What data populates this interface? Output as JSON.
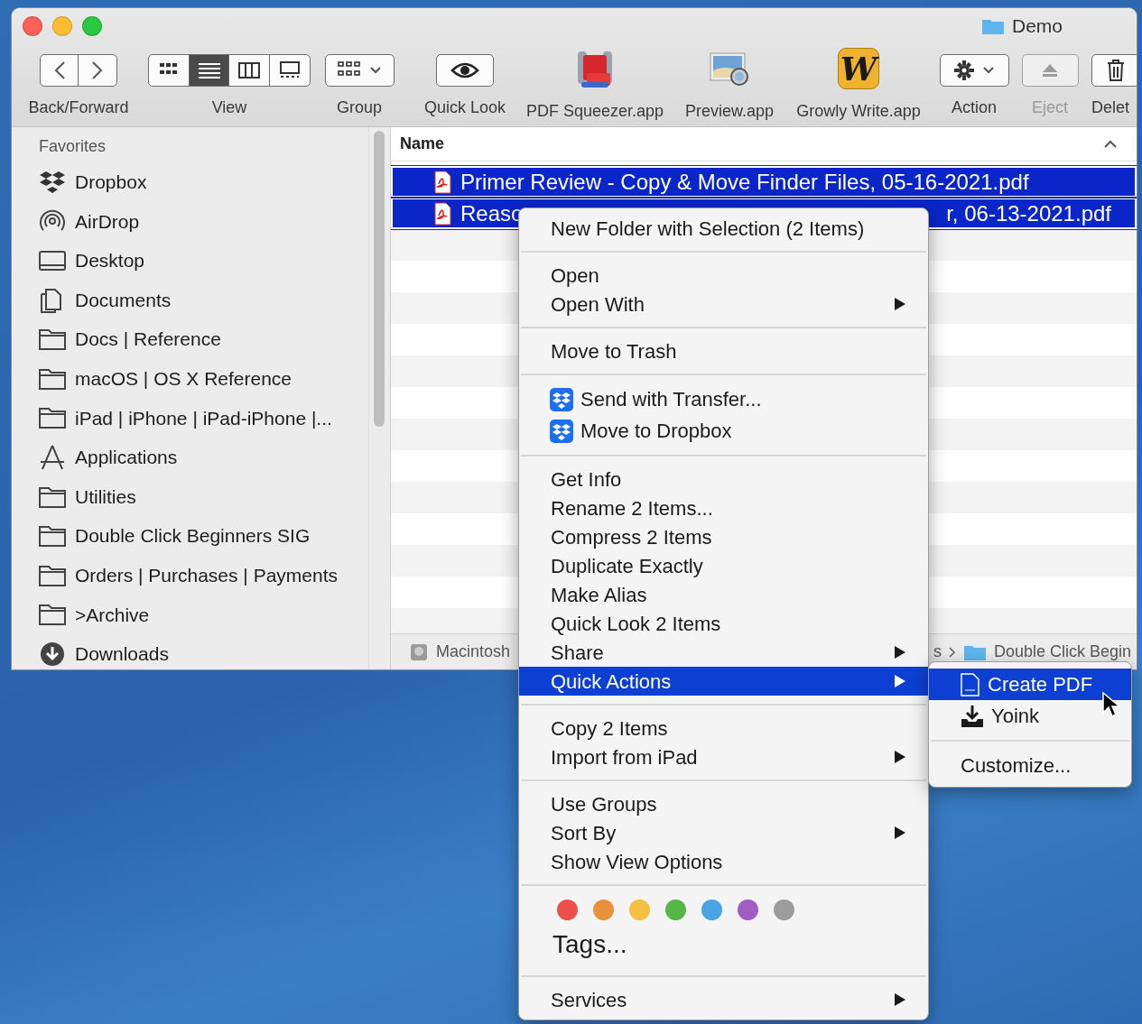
{
  "window": {
    "title": "Demo"
  },
  "toolbar": [
    {
      "kind": "navigation",
      "label": "Back/Forward"
    },
    {
      "kind": "viewmodes",
      "label": "View",
      "modes": [
        {
          "selected": false
        },
        {
          "selected": true
        },
        {
          "selected": false
        },
        {
          "selected": false
        }
      ]
    },
    {
      "kind": "groupmenu",
      "label": "Group"
    },
    {
      "kind": "quicklook",
      "label": "Quick Look"
    },
    {
      "kind": "pdfapp",
      "label": "PDF Squeezer.app"
    },
    {
      "kind": "previewapp",
      "label": "Preview.app"
    },
    {
      "kind": "writeapp",
      "label": "Growly Write.app",
      "icon_text": "W"
    },
    {
      "kind": "actionmenu",
      "label": "Action"
    },
    {
      "kind": "eject",
      "label": "Eject",
      "disabled": true
    },
    {
      "kind": "delete",
      "label": "Delet",
      "disabled": false
    }
  ],
  "sidebar": {
    "heading": "Favorites",
    "items": [
      {
        "kind": "dropbox",
        "label": "Dropbox"
      },
      {
        "kind": "airdrop",
        "label": "AirDrop"
      },
      {
        "kind": "desktop",
        "label": "Desktop"
      },
      {
        "kind": "documents",
        "label": "Documents"
      },
      {
        "kind": "folder",
        "label": "Docs | Reference"
      },
      {
        "kind": "folder",
        "label": "macOS | OS X Reference"
      },
      {
        "kind": "folder",
        "label": "iPad | iPhone | iPad-iPhone |..."
      },
      {
        "kind": "applications",
        "label": "Applications"
      },
      {
        "kind": "folder",
        "label": "Utilities"
      },
      {
        "kind": "folder",
        "label": "Double Click Beginners SIG"
      },
      {
        "kind": "folder",
        "label": "Orders | Purchases | Payments"
      },
      {
        "kind": "folder",
        "label": ">Archive"
      },
      {
        "kind": "downloads",
        "label": "Downloads"
      }
    ]
  },
  "file_list": {
    "columns": [
      {
        "label": "Name",
        "sorted_ascending": true
      }
    ],
    "rows": [
      {
        "name_start": "Primer Review - Copy & Move Finder Files, 05-16-2021.pdf",
        "selected": true
      },
      {
        "name_start": "Reaso",
        "name_end": "r, 06-13-2021.pdf",
        "selected": true
      }
    ]
  },
  "status_bar": {
    "path": [
      {
        "kind": "disk",
        "text": "Macintosh"
      },
      {
        "kind": "plain",
        "text": "s"
      },
      {
        "kind": "folder",
        "text": "Double Click Begin"
      }
    ]
  },
  "context_menu": {
    "sections": [
      {
        "items": [
          {
            "kind": "item",
            "label": "New Folder with Selection (2 Items)",
            "submenu": false,
            "selected": false
          }
        ]
      },
      {
        "items": [
          {
            "kind": "item",
            "label": "Open",
            "submenu": false,
            "selected": false
          },
          {
            "kind": "item",
            "label": "Open With",
            "submenu": true,
            "selected": false
          }
        ]
      },
      {
        "items": [
          {
            "kind": "item",
            "label": "Move to Trash",
            "submenu": false,
            "selected": false
          }
        ]
      },
      {
        "items": [
          {
            "kind": "dropbox",
            "label": "Send with Transfer...",
            "submenu": false,
            "selected": false
          },
          {
            "kind": "dropbox",
            "label": "Move to Dropbox",
            "submenu": false,
            "selected": false
          }
        ]
      },
      {
        "items": [
          {
            "kind": "item",
            "label": "Get Info",
            "submenu": false,
            "selected": false
          },
          {
            "kind": "item",
            "label": "Rename 2 Items...",
            "submenu": false,
            "selected": false
          },
          {
            "kind": "item",
            "label": "Compress 2 Items",
            "submenu": false,
            "selected": false
          },
          {
            "kind": "item",
            "label": "Duplicate Exactly",
            "submenu": false,
            "selected": false
          },
          {
            "kind": "item",
            "label": "Make Alias",
            "submenu": false,
            "selected": false
          },
          {
            "kind": "item",
            "label": "Quick Look 2 Items",
            "submenu": false,
            "selected": false
          },
          {
            "kind": "item",
            "label": "Share",
            "submenu": true,
            "selected": false
          },
          {
            "kind": "item",
            "label": "Quick Actions",
            "submenu": true,
            "selected": true
          }
        ]
      },
      {
        "items": [
          {
            "kind": "item",
            "label": "Copy 2 Items",
            "submenu": false,
            "selected": false
          },
          {
            "kind": "item",
            "label": "Import from iPad",
            "submenu": true,
            "selected": false
          }
        ]
      },
      {
        "items": [
          {
            "kind": "item",
            "label": "Use Groups",
            "submenu": false,
            "selected": false
          },
          {
            "kind": "item",
            "label": "Sort By",
            "submenu": true,
            "selected": false
          },
          {
            "kind": "item",
            "label": "Show View Options",
            "submenu": false,
            "selected": false
          }
        ]
      },
      {
        "items": [
          {
            "kind": "tags",
            "label": "Tags...",
            "selected": false,
            "tags": [
              {
                "color": "#ef4f4a"
              },
              {
                "color": "#e8903a"
              },
              {
                "color": "#f5bf3f"
              },
              {
                "color": "#56b646"
              },
              {
                "color": "#4aa3e6"
              },
              {
                "color": "#a35cc4"
              },
              {
                "color": "#9c9c9c"
              }
            ]
          }
        ]
      },
      {
        "items": [
          {
            "kind": "item",
            "label": "Services",
            "submenu": true,
            "selected": false
          }
        ]
      }
    ]
  },
  "submenu": {
    "sections": [
      {
        "items": [
          {
            "kind": "pdf",
            "label": "Create PDF",
            "selected": true
          },
          {
            "kind": "yoink",
            "label": "Yoink",
            "selected": false
          }
        ]
      },
      {
        "items": [
          {
            "kind": "item",
            "label": "Customize...",
            "selected": false
          }
        ]
      }
    ]
  }
}
